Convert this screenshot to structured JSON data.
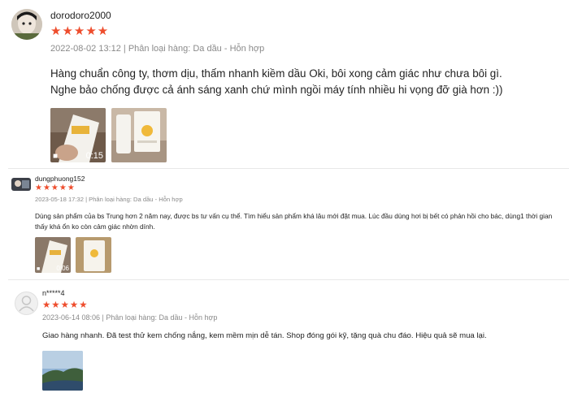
{
  "reviews": [
    {
      "username": "dorodoro2000",
      "stars": "★★★★★",
      "meta": "2022-08-02 13:12 | Phân loại hàng: Da dầu - Hỗn hợp",
      "content_line1": "Hàng chuẩn công ty, thơm dịu, thấm nhanh kiềm dầu Oki, bôi xong cảm giác như chưa bôi gì.",
      "content_line2": "Nghe bảo chống được cả ánh sáng xanh chứ mình ngồi máy tính nhiều hi vọng đỡ già hơn :))",
      "video_duration": "0:15"
    },
    {
      "username": "dungphuong152",
      "stars": "★★★★★",
      "meta": "2023-05-18 17:32 | Phân loại hàng: Da dầu - Hỗn hợp",
      "content_line1": "Dùng sản phẩm của bs Trung hơn 2 năm nay, được bs tư vấn cụ thể. Tìm hiểu sản phẩm khá lâu mới đặt mua. Lúc đầu dùng hơi bị bết có phản hồi cho bác, dùng1 thời gian",
      "content_line2": "thấy khá ổn ko còn cảm giác nhờn dính.",
      "video_duration": "0:06"
    },
    {
      "username": "n*****4",
      "stars": "★★★★★",
      "meta": "2023-06-14 08:06 | Phân loại hàng: Da dầu - Hỗn hợp",
      "content_line1": "Giao hàng nhanh. Đã test thử kem chống nắng, kem mềm mịn dễ tán. Shop đóng gói kỹ, tặng quà chu đáo. Hiệu quả sẽ mua lại."
    }
  ],
  "colors": {
    "star": "#ee4d2d",
    "meta": "#8a8a8a",
    "text": "#222222"
  }
}
